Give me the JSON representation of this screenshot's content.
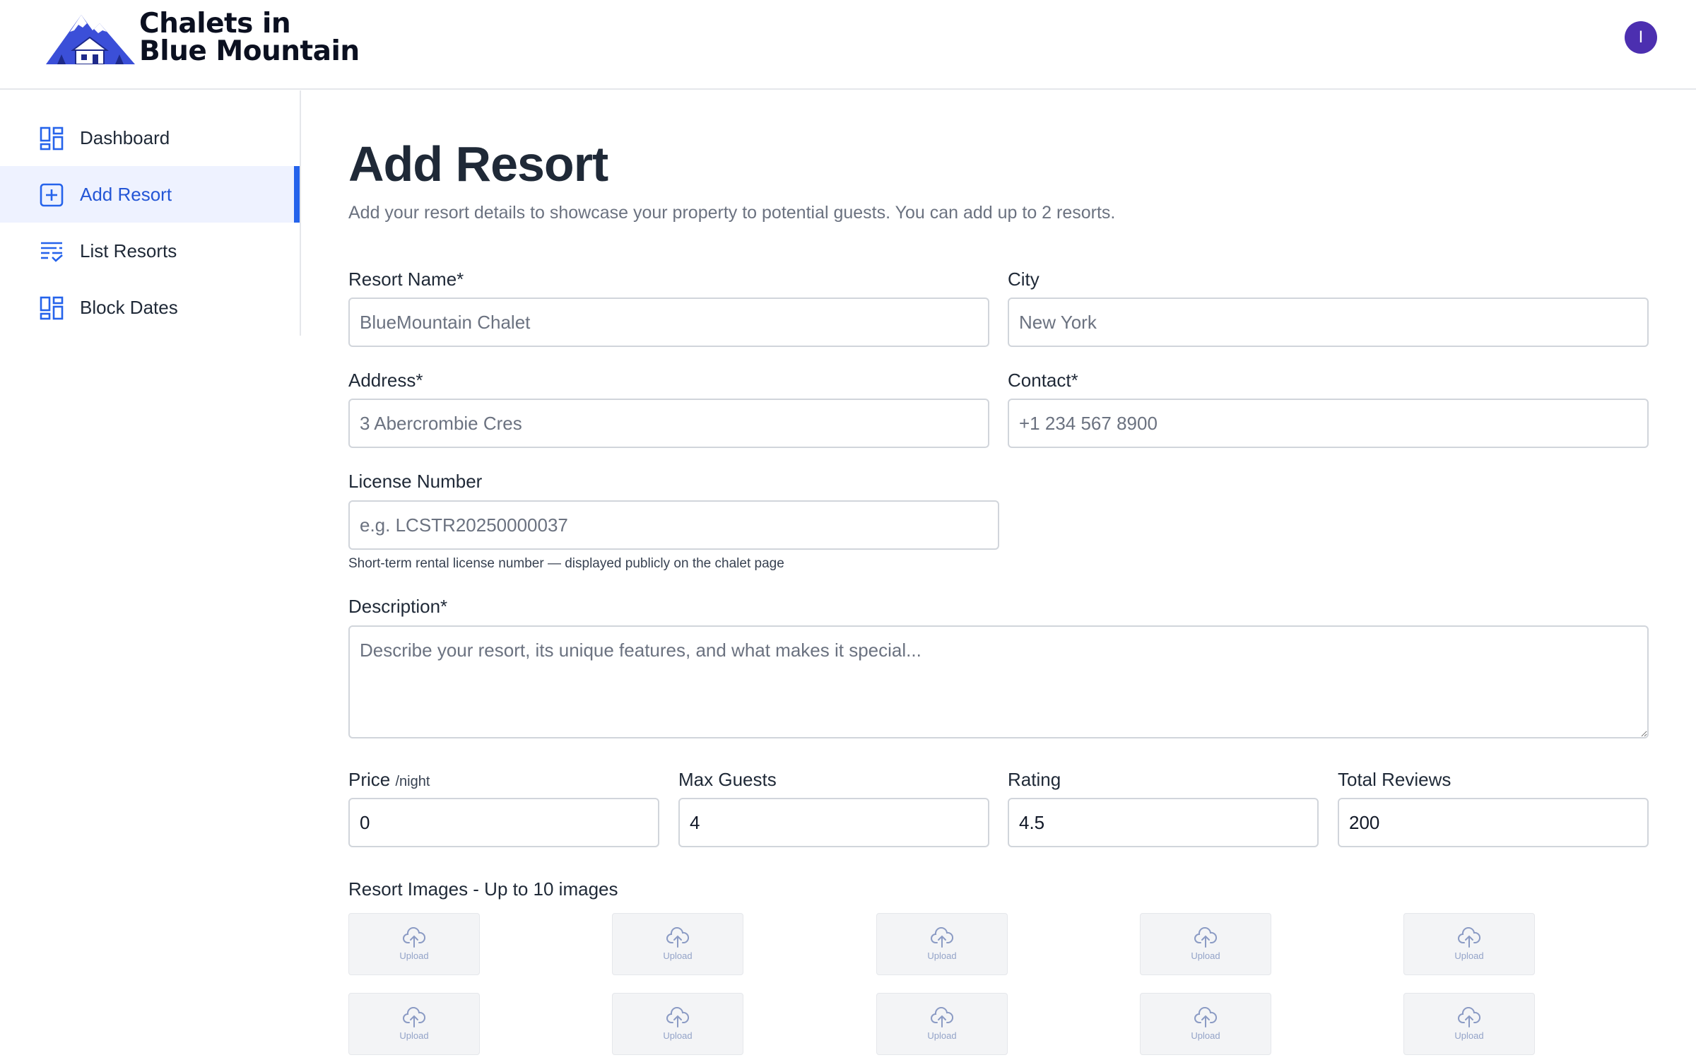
{
  "header": {
    "brand_line1": "Chalets in",
    "brand_line2": "Blue Mountain",
    "avatar_initial": "I",
    "logo_icon": "mountain-chalet-logo"
  },
  "sidebar": {
    "items": [
      {
        "label": "Dashboard",
        "icon": "dashboard-icon"
      },
      {
        "label": "Add Resort",
        "icon": "plus-square-icon",
        "active": true
      },
      {
        "label": "List Resorts",
        "icon": "list-check-icon"
      },
      {
        "label": "Block Dates",
        "icon": "dashboard-icon"
      }
    ]
  },
  "main": {
    "title": "Add Resort",
    "subtitle": "Add your resort details to showcase your property to potential guests. You can add up to 2 resorts.",
    "fields": {
      "resort_name": {
        "label": "Resort Name*",
        "placeholder": "BlueMountain Chalet",
        "value": ""
      },
      "city": {
        "label": "City",
        "placeholder": "New York",
        "value": ""
      },
      "address": {
        "label": "Address*",
        "placeholder": "3 Abercrombie Cres",
        "value": ""
      },
      "contact": {
        "label": "Contact*",
        "placeholder": "+1 234 567 8900",
        "value": ""
      },
      "license": {
        "label": "License Number",
        "placeholder": "e.g. LCSTR20250000037",
        "value": "",
        "hint": "Short-term rental license number — displayed publicly on the chalet page"
      },
      "description": {
        "label": "Description*",
        "placeholder": "Describe your resort, its unique features, and what makes it special...",
        "value": ""
      },
      "price": {
        "label": "Price",
        "unit": "/night",
        "value": "0"
      },
      "max_guests": {
        "label": "Max Guests",
        "value": "4"
      },
      "rating": {
        "label": "Rating",
        "value": "4.5"
      },
      "total_reviews": {
        "label": "Total Reviews",
        "value": "200"
      }
    },
    "images": {
      "label": "Resort Images - Up to 10 images",
      "slot_label": "Upload",
      "slot_icon": "cloud-upload-icon",
      "slot_count": 10
    }
  },
  "colors": {
    "accent": "#2563eb",
    "active_bg": "#eef2ff",
    "avatar_bg": "#4c2fb0",
    "logo_blue": "#3b4fd8"
  }
}
